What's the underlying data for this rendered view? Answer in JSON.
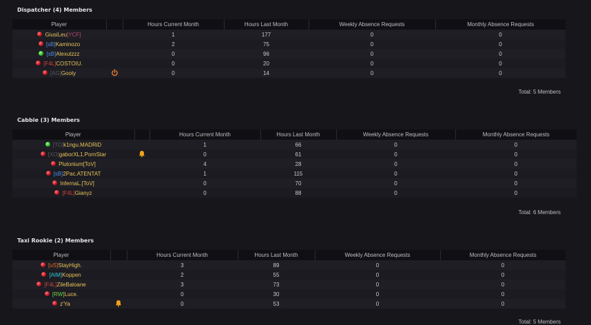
{
  "columns": {
    "player": "Player",
    "hours_current": "Hours Current Month",
    "hours_last": "Hours Last Month",
    "weekly": "Weekly Absence Requests",
    "monthly": "Monthly Absence Requests"
  },
  "colors": {
    "bg": "#16161b",
    "name": "#e8c35a",
    "online": "#2cb52a",
    "offline": "#c1121f"
  },
  "sections": [
    {
      "title": "Dispatcher (4) Members",
      "total": "Total: 5 Members",
      "rows": [
        {
          "status": "offline",
          "tag": "",
          "name": "GiusiLeu",
          "suffix": "[YCF]",
          "suffix_color": "pink",
          "icon": "",
          "current": "1",
          "last": "177",
          "weekly": "0",
          "monthly": "0"
        },
        {
          "status": "offline",
          "tag": "[sB]",
          "tag_color": "blue",
          "name": "Kaminozo",
          "icon": "",
          "current": "2",
          "last": "75",
          "weekly": "0",
          "monthly": "0"
        },
        {
          "status": "online",
          "tag": "[sB]",
          "tag_color": "blue",
          "name": "Alexutzzz",
          "icon": "",
          "current": "0",
          "last": "96",
          "weekly": "0",
          "monthly": "0"
        },
        {
          "status": "offline",
          "tag": "[F4L]",
          "tag_color": "red",
          "name": "COSTOIU.",
          "icon": "",
          "current": "0",
          "last": "20",
          "weekly": "0",
          "monthly": "0"
        },
        {
          "status": "offline",
          "tag": "[AG]",
          "tag_color": "gray",
          "name": "Gooty",
          "icon": "power-icon",
          "current": "0",
          "last": "14",
          "weekly": "0",
          "monthly": "0"
        }
      ]
    },
    {
      "title": "Cabbie (3) Members",
      "total": "Total: 6 Members",
      "rows": [
        {
          "status": "online",
          "tag": "[TO]",
          "tag_color": "gray",
          "name": "k1ngu.MADRiD",
          "icon": "",
          "current": "1",
          "last": "66",
          "weekly": "0",
          "monthly": "0"
        },
        {
          "status": "offline",
          "tag": "[XO]",
          "tag_color": "gray",
          "name": "gaborXL1.PornStar",
          "icon": "bell-icon",
          "current": "0",
          "last": "61",
          "weekly": "0",
          "monthly": "0"
        },
        {
          "status": "offline",
          "tag": "",
          "name": "Plutonium[ToV]",
          "icon": "",
          "current": "4",
          "last": "28",
          "weekly": "0",
          "monthly": "0"
        },
        {
          "status": "offline",
          "tag": "[sB]",
          "tag_color": "blue",
          "name": "2Pac.ATENTAT",
          "icon": "",
          "current": "1",
          "last": "115",
          "weekly": "0",
          "monthly": "0"
        },
        {
          "status": "offline",
          "tag": "",
          "name": "InfernaL.[ToV]",
          "icon": "",
          "current": "0",
          "last": "70",
          "weekly": "0",
          "monthly": "0"
        },
        {
          "status": "offline",
          "tag": "[F4L]",
          "tag_color": "red",
          "name": "Gianyz",
          "icon": "",
          "current": "0",
          "last": "88",
          "weekly": "0",
          "monthly": "0"
        }
      ]
    },
    {
      "title": "Taxi Rookie (2) Members",
      "total": "Total: 5 Members",
      "rows": [
        {
          "status": "offline",
          "tag": "[uS]",
          "tag_color": "orange",
          "name": "StayHigh.",
          "icon": "",
          "current": "3",
          "last": "89",
          "weekly": "0",
          "monthly": "0"
        },
        {
          "status": "offline",
          "tag": "[AIM]",
          "tag_color": "cyan",
          "name": "Koppen",
          "icon": "",
          "current": "2",
          "last": "55",
          "weekly": "0",
          "monthly": "0"
        },
        {
          "status": "offline",
          "tag": "[F4L]",
          "tag_color": "red",
          "name": "ZileBaloane",
          "icon": "",
          "current": "3",
          "last": "73",
          "weekly": "0",
          "monthly": "0"
        },
        {
          "status": "offline",
          "tag": "[RW]",
          "tag_color": "green",
          "name": "Luce.",
          "icon": "",
          "current": "0",
          "last": "30",
          "weekly": "0",
          "monthly": "0"
        },
        {
          "status": "offline",
          "tag": "",
          "name": "z'Ya",
          "icon": "bell-icon",
          "current": "0",
          "last": "53",
          "weekly": "0",
          "monthly": "0"
        }
      ]
    }
  ]
}
